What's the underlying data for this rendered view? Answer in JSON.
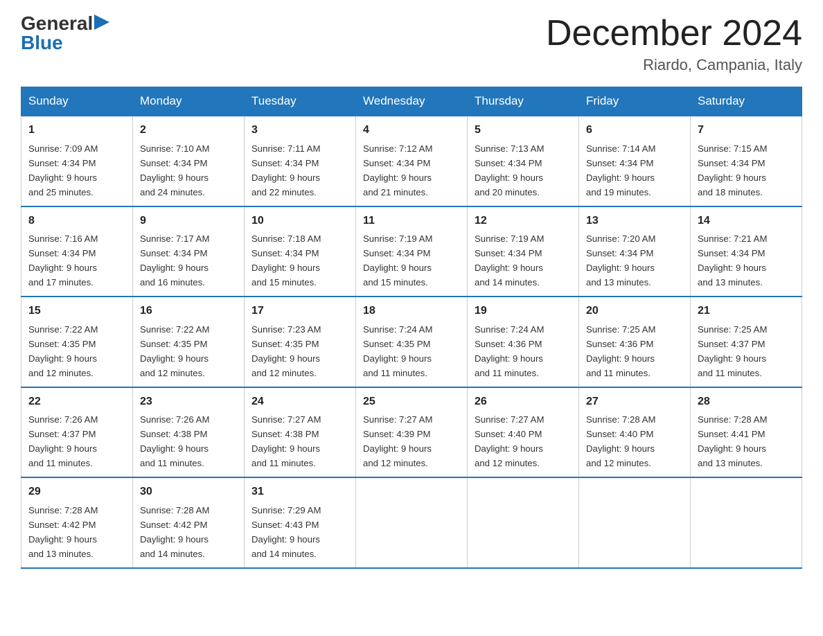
{
  "header": {
    "logo_general": "General",
    "logo_blue": "Blue",
    "month_title": "December 2024",
    "location": "Riardo, Campania, Italy"
  },
  "weekdays": [
    "Sunday",
    "Monday",
    "Tuesday",
    "Wednesday",
    "Thursday",
    "Friday",
    "Saturday"
  ],
  "weeks": [
    [
      {
        "day": "1",
        "sunrise": "7:09 AM",
        "sunset": "4:34 PM",
        "daylight": "9 hours and 25 minutes."
      },
      {
        "day": "2",
        "sunrise": "7:10 AM",
        "sunset": "4:34 PM",
        "daylight": "9 hours and 24 minutes."
      },
      {
        "day": "3",
        "sunrise": "7:11 AM",
        "sunset": "4:34 PM",
        "daylight": "9 hours and 22 minutes."
      },
      {
        "day": "4",
        "sunrise": "7:12 AM",
        "sunset": "4:34 PM",
        "daylight": "9 hours and 21 minutes."
      },
      {
        "day": "5",
        "sunrise": "7:13 AM",
        "sunset": "4:34 PM",
        "daylight": "9 hours and 20 minutes."
      },
      {
        "day": "6",
        "sunrise": "7:14 AM",
        "sunset": "4:34 PM",
        "daylight": "9 hours and 19 minutes."
      },
      {
        "day": "7",
        "sunrise": "7:15 AM",
        "sunset": "4:34 PM",
        "daylight": "9 hours and 18 minutes."
      }
    ],
    [
      {
        "day": "8",
        "sunrise": "7:16 AM",
        "sunset": "4:34 PM",
        "daylight": "9 hours and 17 minutes."
      },
      {
        "day": "9",
        "sunrise": "7:17 AM",
        "sunset": "4:34 PM",
        "daylight": "9 hours and 16 minutes."
      },
      {
        "day": "10",
        "sunrise": "7:18 AM",
        "sunset": "4:34 PM",
        "daylight": "9 hours and 15 minutes."
      },
      {
        "day": "11",
        "sunrise": "7:19 AM",
        "sunset": "4:34 PM",
        "daylight": "9 hours and 15 minutes."
      },
      {
        "day": "12",
        "sunrise": "7:19 AM",
        "sunset": "4:34 PM",
        "daylight": "9 hours and 14 minutes."
      },
      {
        "day": "13",
        "sunrise": "7:20 AM",
        "sunset": "4:34 PM",
        "daylight": "9 hours and 13 minutes."
      },
      {
        "day": "14",
        "sunrise": "7:21 AM",
        "sunset": "4:34 PM",
        "daylight": "9 hours and 13 minutes."
      }
    ],
    [
      {
        "day": "15",
        "sunrise": "7:22 AM",
        "sunset": "4:35 PM",
        "daylight": "9 hours and 12 minutes."
      },
      {
        "day": "16",
        "sunrise": "7:22 AM",
        "sunset": "4:35 PM",
        "daylight": "9 hours and 12 minutes."
      },
      {
        "day": "17",
        "sunrise": "7:23 AM",
        "sunset": "4:35 PM",
        "daylight": "9 hours and 12 minutes."
      },
      {
        "day": "18",
        "sunrise": "7:24 AM",
        "sunset": "4:35 PM",
        "daylight": "9 hours and 11 minutes."
      },
      {
        "day": "19",
        "sunrise": "7:24 AM",
        "sunset": "4:36 PM",
        "daylight": "9 hours and 11 minutes."
      },
      {
        "day": "20",
        "sunrise": "7:25 AM",
        "sunset": "4:36 PM",
        "daylight": "9 hours and 11 minutes."
      },
      {
        "day": "21",
        "sunrise": "7:25 AM",
        "sunset": "4:37 PM",
        "daylight": "9 hours and 11 minutes."
      }
    ],
    [
      {
        "day": "22",
        "sunrise": "7:26 AM",
        "sunset": "4:37 PM",
        "daylight": "9 hours and 11 minutes."
      },
      {
        "day": "23",
        "sunrise": "7:26 AM",
        "sunset": "4:38 PM",
        "daylight": "9 hours and 11 minutes."
      },
      {
        "day": "24",
        "sunrise": "7:27 AM",
        "sunset": "4:38 PM",
        "daylight": "9 hours and 11 minutes."
      },
      {
        "day": "25",
        "sunrise": "7:27 AM",
        "sunset": "4:39 PM",
        "daylight": "9 hours and 12 minutes."
      },
      {
        "day": "26",
        "sunrise": "7:27 AM",
        "sunset": "4:40 PM",
        "daylight": "9 hours and 12 minutes."
      },
      {
        "day": "27",
        "sunrise": "7:28 AM",
        "sunset": "4:40 PM",
        "daylight": "9 hours and 12 minutes."
      },
      {
        "day": "28",
        "sunrise": "7:28 AM",
        "sunset": "4:41 PM",
        "daylight": "9 hours and 13 minutes."
      }
    ],
    [
      {
        "day": "29",
        "sunrise": "7:28 AM",
        "sunset": "4:42 PM",
        "daylight": "9 hours and 13 minutes."
      },
      {
        "day": "30",
        "sunrise": "7:28 AM",
        "sunset": "4:42 PM",
        "daylight": "9 hours and 14 minutes."
      },
      {
        "day": "31",
        "sunrise": "7:29 AM",
        "sunset": "4:43 PM",
        "daylight": "9 hours and 14 minutes."
      },
      null,
      null,
      null,
      null
    ]
  ],
  "labels": {
    "sunrise": "Sunrise:",
    "sunset": "Sunset:",
    "daylight": "Daylight:"
  }
}
